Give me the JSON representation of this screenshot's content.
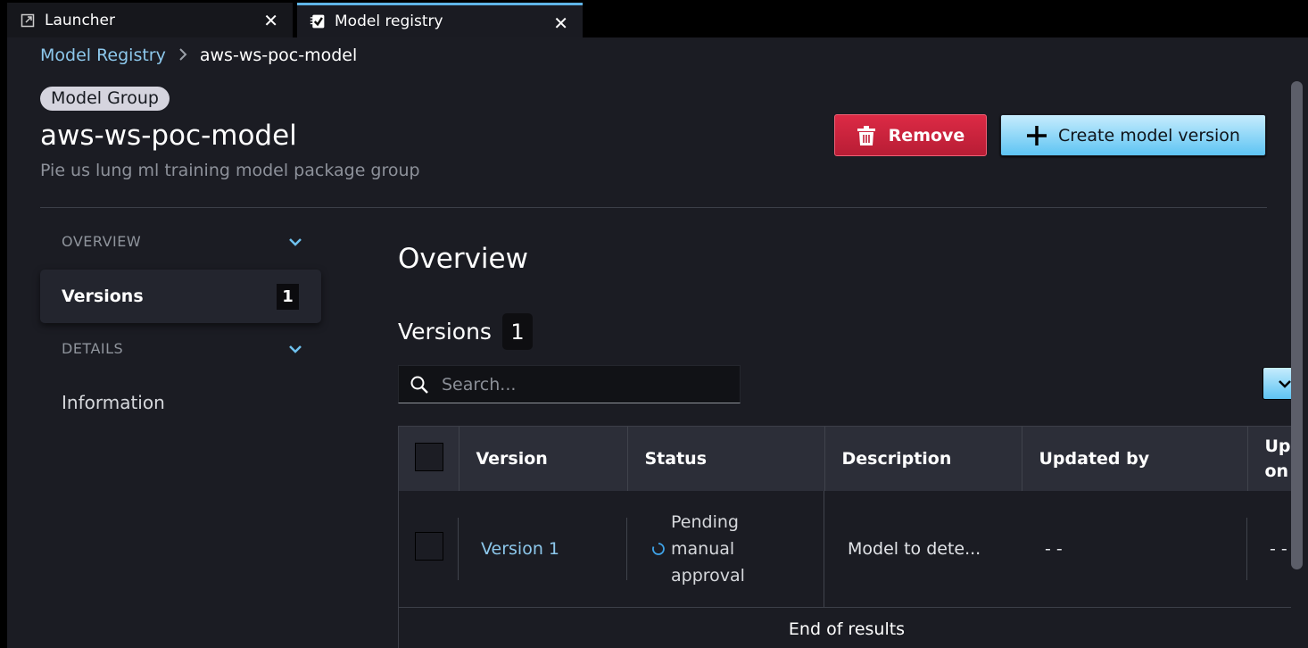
{
  "tabs": [
    {
      "label": "Launcher",
      "icon": "external-link-icon",
      "active": false
    },
    {
      "label": "Model registry",
      "icon": "checklist-icon",
      "active": true
    }
  ],
  "breadcrumb": {
    "parent": "Model Registry",
    "separator": ">",
    "current": "aws-ws-poc-model"
  },
  "header": {
    "badge": "Model Group",
    "title": "aws-ws-poc-model",
    "subtitle": "Pie us lung ml training model package group",
    "remove_label": "Remove",
    "create_label": "Create model version"
  },
  "sidenav": {
    "overview_section": "OVERVIEW",
    "versions_label": "Versions",
    "versions_count": "1",
    "details_section": "DETAILS",
    "information_label": "Information"
  },
  "content": {
    "overview_title": "Overview",
    "versions_title": "Versions",
    "versions_count": "1",
    "search_placeholder": "Search...",
    "search_value": ""
  },
  "table": {
    "columns": [
      "Version",
      "Status",
      "Description",
      "Updated by",
      "Updated on"
    ],
    "rows": [
      {
        "version": "Version 1",
        "status": "Pending manual approval",
        "status_line1": "Pending",
        "status_line2": "manual",
        "status_line3": "approval",
        "description": "Model to dete...",
        "updated_by": "- -",
        "updated_on": "- -"
      }
    ],
    "footer": "End of results"
  },
  "colors": {
    "accent": "#5ec4f3",
    "link": "#8dc8ec",
    "danger": "#dc2a45",
    "background": "#1b1c23"
  }
}
